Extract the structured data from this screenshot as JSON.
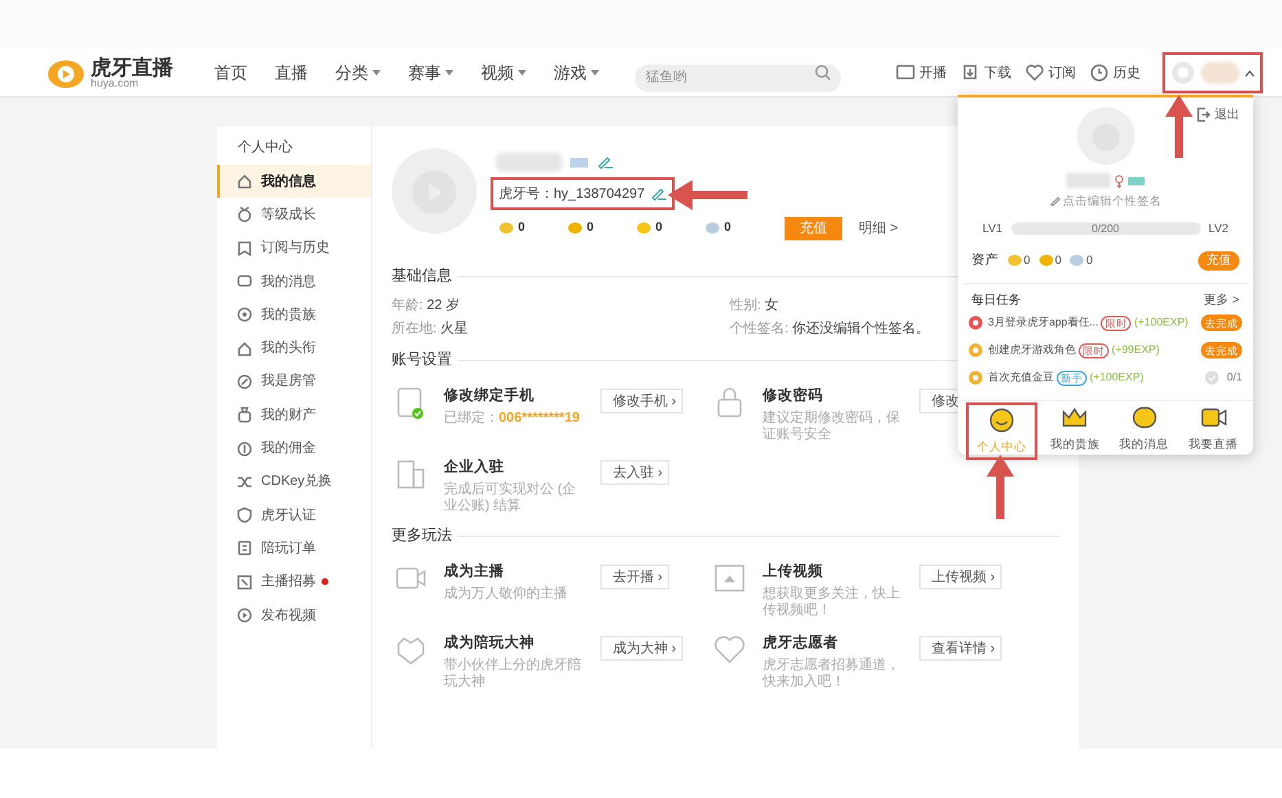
{
  "header": {
    "logo_title": "虎牙直播",
    "logo_subtitle": "huya.com",
    "nav": [
      {
        "label": "首页",
        "dropdown": false
      },
      {
        "label": "直播",
        "dropdown": false
      },
      {
        "label": "分类",
        "dropdown": true
      },
      {
        "label": "赛事",
        "dropdown": true
      },
      {
        "label": "视频",
        "dropdown": true
      },
      {
        "label": "游戏",
        "dropdown": true
      }
    ],
    "search": {
      "placeholder": "猛鱼哟"
    },
    "actions": [
      "开播",
      "下载",
      "订阅",
      "历史"
    ]
  },
  "sidebar": {
    "title": "个人中心",
    "items": [
      {
        "label": "我的信息",
        "selected": true,
        "badge": false
      },
      {
        "label": "等级成长",
        "selected": false,
        "badge": false
      },
      {
        "label": "订阅与历史",
        "selected": false,
        "badge": false
      },
      {
        "label": "我的消息",
        "selected": false,
        "badge": false
      },
      {
        "label": "我的贵族",
        "selected": false,
        "badge": false
      },
      {
        "label": "我的头衔",
        "selected": false,
        "badge": false
      },
      {
        "label": "我是房管",
        "selected": false,
        "badge": false
      },
      {
        "label": "我的财产",
        "selected": false,
        "badge": false
      },
      {
        "label": "我的佣金",
        "selected": false,
        "badge": false
      },
      {
        "label": "CDKey兑换",
        "selected": false,
        "badge": false
      },
      {
        "label": "虎牙认证",
        "selected": false,
        "badge": false
      },
      {
        "label": "陪玩订单",
        "selected": false,
        "badge": false
      },
      {
        "label": "主播招募",
        "selected": false,
        "badge": true
      },
      {
        "label": "发布视频",
        "selected": false,
        "badge": false
      }
    ]
  },
  "profile": {
    "id_text": "虎牙号：hy_138704297",
    "balances": [
      {
        "value": "0",
        "color": "#f2c230"
      },
      {
        "value": "0",
        "color": "#f0b400"
      },
      {
        "value": "0",
        "color": "#f5c518"
      },
      {
        "value": "0",
        "color": "#b9cde0"
      }
    ],
    "recharge": "充值",
    "details": "明细 >"
  },
  "basic_info": {
    "title": "基础信息",
    "fields": [
      {
        "label": "年龄:",
        "value": "22 岁"
      },
      {
        "label": "性别:",
        "value": "女"
      },
      {
        "label": "所在地:",
        "value": "火星"
      },
      {
        "label": "个性签名:",
        "value": "你还没编辑个性签名。"
      }
    ]
  },
  "account_settings": {
    "title": "账号设置",
    "items": [
      {
        "title": "修改绑定手机",
        "desc": "已绑定：",
        "highlight": "006********19",
        "button": "修改手机 ›"
      },
      {
        "title": "修改密码",
        "desc": "建议定期修改密码，保证账号安全",
        "button": "修改"
      },
      {
        "title": "企业入驻",
        "desc": "完成后可实现对公 (企业公账) 结算",
        "button": "去入驻 ›"
      }
    ]
  },
  "more": {
    "title": "更多玩法",
    "items": [
      {
        "title": "成为主播",
        "desc": "成为万人敬仰的主播",
        "button": "去开播 ›"
      },
      {
        "title": "上传视频",
        "desc": "想获取更多关注，快上传视频吧！",
        "button": "上传视频 ›"
      },
      {
        "title": "成为陪玩大神",
        "desc": "带小伙伴上分的虎牙陪玩大神",
        "button": "成为大神 ›"
      },
      {
        "title": "虎牙志愿者",
        "desc": "虎牙志愿者招募通道，快来加入吧！",
        "button": "查看详情 ›"
      }
    ]
  },
  "user_popup": {
    "logout": "退出",
    "signature_hint": "点击编辑个性签名",
    "level_from": "LV1",
    "level_to": "LV2",
    "progress_text": "0/200",
    "level": 0,
    "assets_label": "资产",
    "assets": [
      {
        "value": "0",
        "color": "#f2c230"
      },
      {
        "value": "0",
        "color": "#f0b400"
      },
      {
        "value": "0",
        "color": "#b9cde0"
      }
    ],
    "recharge": "充值",
    "tasks_title": "每日任务",
    "more": "更多 >",
    "tasks": [
      {
        "name": "3月登录虎牙app看任...",
        "tag": {
          "label": "限时",
          "color": "#e05a5a"
        },
        "reward": "(+100EXP)",
        "color": "#e85555",
        "kind": "action",
        "action": "去完成"
      },
      {
        "name": "创建虎牙游戏角色",
        "tag": {
          "label": "限时",
          "color": "#e05a5a"
        },
        "reward": "(+99EXP)",
        "color": "#f2b233",
        "kind": "action",
        "action": "去完成"
      },
      {
        "name": "首次充值金豆",
        "tag": {
          "label": "新手",
          "color": "#3fa7d6"
        },
        "reward": "(+100EXP)",
        "color": "#f2b233",
        "kind": "count",
        "count": "0/1"
      }
    ],
    "tabs": [
      {
        "label": "个人中心",
        "selected": true
      },
      {
        "label": "我的贵族",
        "selected": false
      },
      {
        "label": "我的消息",
        "selected": false
      },
      {
        "label": "我要直播",
        "selected": false
      }
    ]
  }
}
